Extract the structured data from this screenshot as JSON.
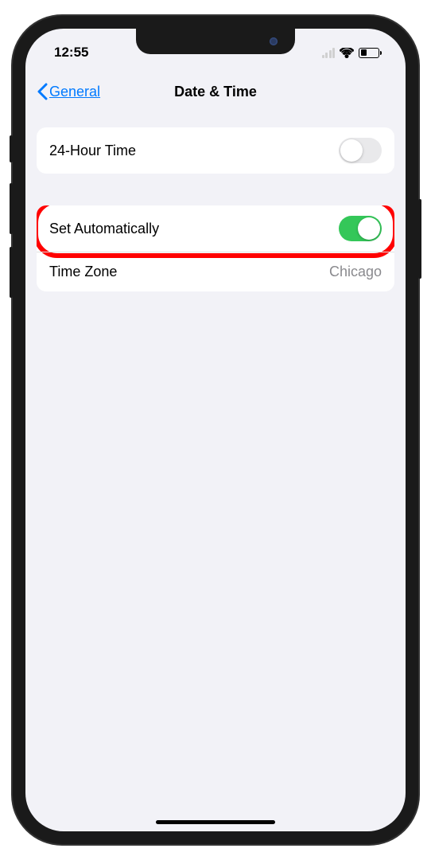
{
  "status": {
    "time": "12:55"
  },
  "nav": {
    "back_label": "General",
    "title": "Date & Time"
  },
  "settings": {
    "twenty_four_hour": {
      "label": "24-Hour Time",
      "enabled": false
    },
    "set_automatically": {
      "label": "Set Automatically",
      "enabled": true
    },
    "time_zone": {
      "label": "Time Zone",
      "value": "Chicago"
    }
  }
}
